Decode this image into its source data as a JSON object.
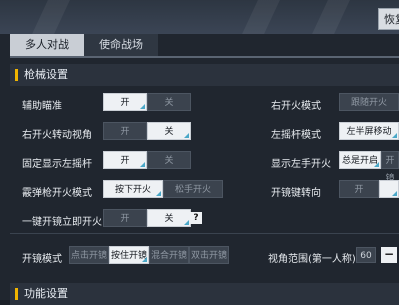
{
  "top": {
    "restore_label": "恢复"
  },
  "tabs": [
    {
      "label": "多人对战"
    },
    {
      "label": "使命战场"
    }
  ],
  "section_weapons": {
    "title": "枪械设置"
  },
  "settings": {
    "aim_assist": {
      "label": "辅助瞄准",
      "on": "开",
      "off": "关"
    },
    "right_fire_mode": {
      "label": "右开火模式",
      "option": "跟随开火"
    },
    "right_fire_turn_view": {
      "label": "右开火转动视角",
      "on": "开",
      "off": "关"
    },
    "left_joystick_mode": {
      "label": "左摇杆模式",
      "option": "左半屏移动"
    },
    "fixed_left_joystick": {
      "label": "固定显示左摇杆",
      "on": "开",
      "off": "关"
    },
    "show_left_fire": {
      "label": "显示左手开火",
      "option1": "总是开启",
      "option2": "开镜"
    },
    "shotgun_fire_mode": {
      "label": "霰弹枪开火模式",
      "opt1": "按下开火",
      "opt2": "松手开火"
    },
    "scope_turn": {
      "label": "开镜键转向",
      "on": "开"
    },
    "one_key_scope_fire": {
      "label": "一键开镜立即开火",
      "on": "开",
      "off": "关",
      "help": "?"
    }
  },
  "scope_mode": {
    "label": "开镜模式",
    "options": [
      "点击开镜",
      "按住开镜",
      "混合开镜",
      "双击开镜"
    ]
  },
  "fov": {
    "label": "视角范围(第一人称)",
    "value": "60",
    "minus": "−"
  },
  "section_function": {
    "title": "功能设置"
  }
}
